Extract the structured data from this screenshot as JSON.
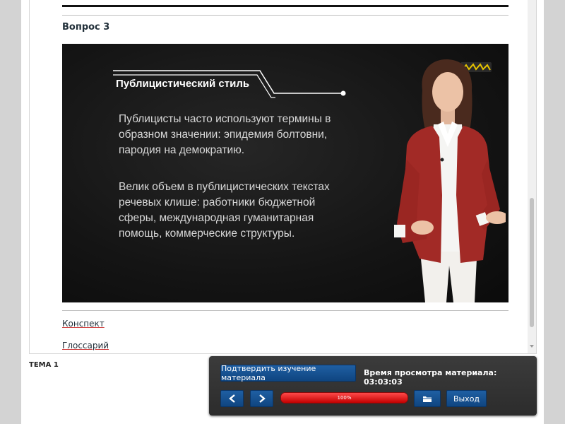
{
  "question": {
    "title": "Вопрос 3"
  },
  "video": {
    "slide_title": "Публицистический стиль",
    "paragraph_1": "Публицисты часто используют термины в образном значении: эпидемия болтовни, пародия на демократию.",
    "paragraph_2": "Велик объем в публицистических текстах речевых клише: работники бюджетной сферы, международная гуманитарная помощь, коммерческие структуры."
  },
  "links": {
    "konspekt": "Конспект",
    "glossary": "Глоссарий"
  },
  "topic": {
    "label": "ТЕМА 1"
  },
  "panel": {
    "confirm_label": "Подтвердить изучение материала",
    "view_time": "Время просмотра материала: 03:03:03",
    "progress_value": 1.0,
    "progress_text": "100%",
    "exit_label": "Выход",
    "prev_icon": "chevron-left-icon",
    "next_icon": "chevron-right-icon",
    "folder_icon": "folder-icon"
  },
  "colors": {
    "accent_blue": "#1a5798",
    "progress_red": "#e02020",
    "jacket_red": "#a22a26"
  }
}
